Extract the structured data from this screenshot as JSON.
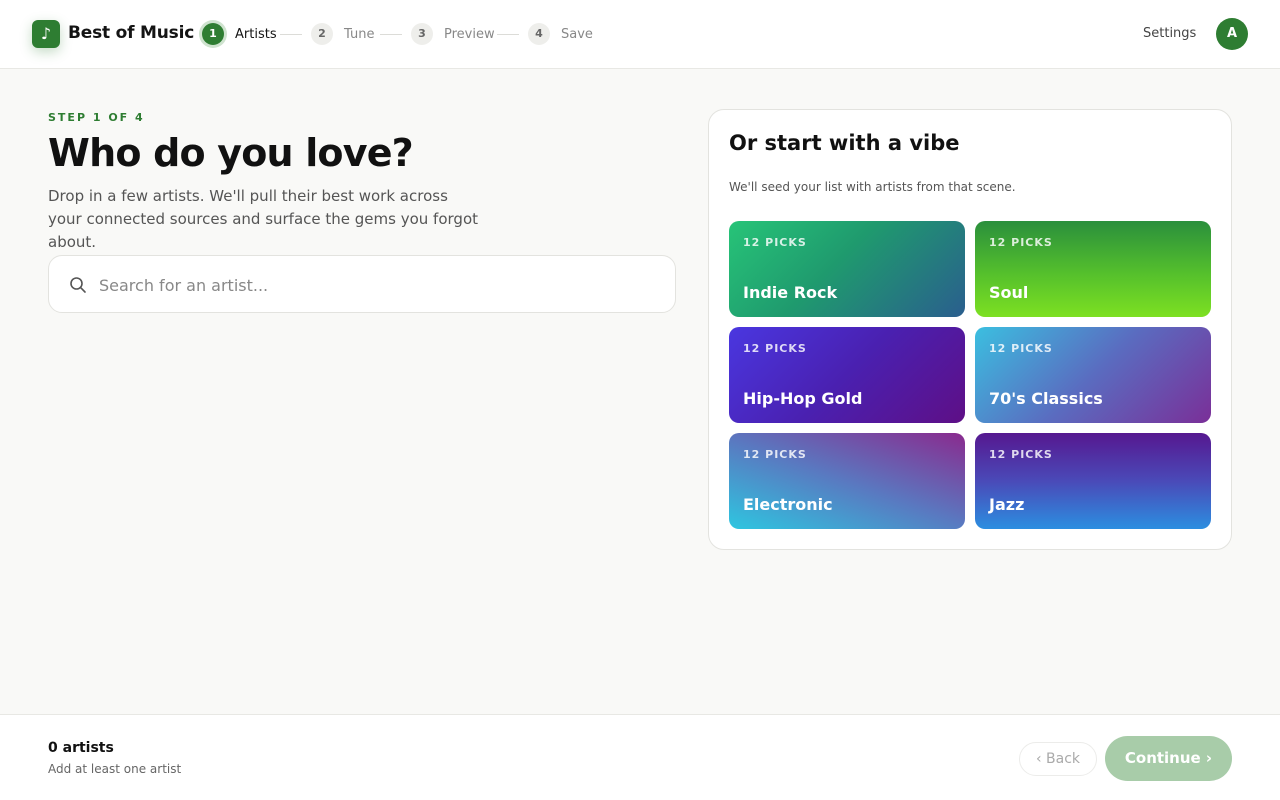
{
  "app": {
    "logo_glyph": "♪",
    "name": "Best of Music",
    "accent": "#2e7d32"
  },
  "stepper": {
    "steps": [
      {
        "num": "1",
        "label": "Artists",
        "active": true
      },
      {
        "num": "2",
        "label": "Tune",
        "active": false
      },
      {
        "num": "3",
        "label": "Preview",
        "active": false
      },
      {
        "num": "4",
        "label": "Save",
        "active": false
      }
    ]
  },
  "header": {
    "settings_label": "Settings",
    "avatar_initial": "A"
  },
  "main": {
    "eyebrow": "STEP 1 OF 4",
    "title": "Who do you love?",
    "subtitle": "Drop in a few artists. We'll pull their best work across your connected sources and surface the gems you forgot about.",
    "search": {
      "placeholder": "Search for an artist...",
      "value": "",
      "icon": "search-icon"
    }
  },
  "vibes": {
    "title": "Or start with a vibe",
    "subtitle": "We'll seed your list with artists from that scene.",
    "tiles": [
      {
        "picks": "12 PICKS",
        "name": "Indie Rock"
      },
      {
        "picks": "12 PICKS",
        "name": "Soul"
      },
      {
        "picks": "12 PICKS",
        "name": "Hip-Hop Gold"
      },
      {
        "picks": "12 PICKS",
        "name": "70's Classics"
      },
      {
        "picks": "12 PICKS",
        "name": "Electronic"
      },
      {
        "picks": "12 PICKS",
        "name": "Jazz"
      }
    ]
  },
  "footer": {
    "count": "0 artists",
    "hint": "Add at least one artist",
    "back_label": "‹ Back",
    "continue_label": "Continue ›"
  }
}
